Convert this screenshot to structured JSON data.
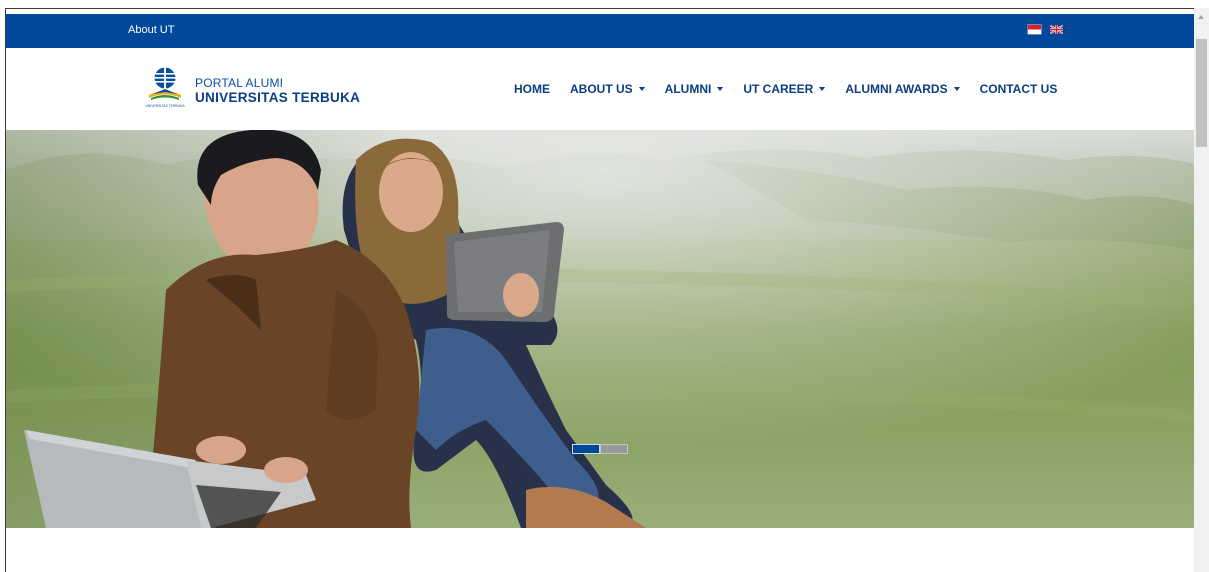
{
  "topbar": {
    "about_label": "About UT",
    "languages": [
      {
        "code": "id",
        "icon": "indonesia-flag-icon"
      },
      {
        "code": "en",
        "icon": "uk-flag-icon"
      }
    ],
    "color": "#01479a"
  },
  "brand": {
    "line1": "PORTAL ALUMI",
    "line2": "UNIVERSITAS TERBUKA",
    "logo_caption": "UNIVERSITAS TERBUKA",
    "logo_icon": "ut-logo-icon"
  },
  "nav": {
    "items": [
      {
        "label": "HOME",
        "dropdown": false
      },
      {
        "label": "ABOUT US",
        "dropdown": true
      },
      {
        "label": "ALUMNI",
        "dropdown": true
      },
      {
        "label": "UT CAREER",
        "dropdown": true
      },
      {
        "label": "ALUMNI AWARDS",
        "dropdown": true
      },
      {
        "label": "CONTACT US",
        "dropdown": false
      }
    ]
  },
  "carousel": {
    "slide_count": 2,
    "active_index": 0,
    "active_color": "#01479a",
    "inactive_color": "#9a9a9a"
  }
}
